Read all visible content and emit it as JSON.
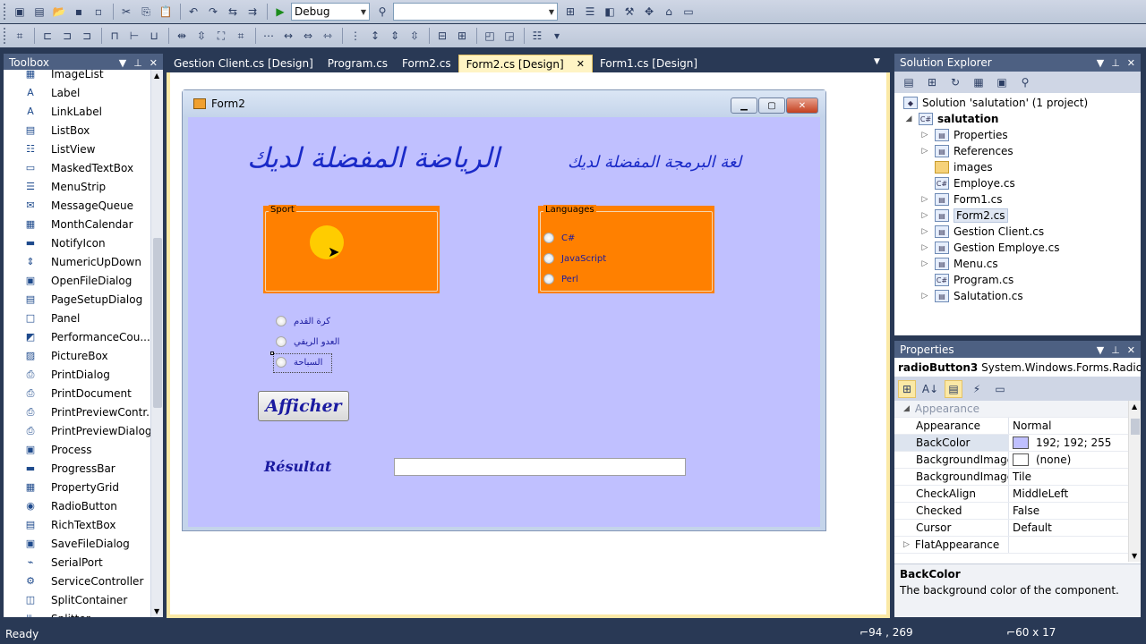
{
  "toolbar1": {
    "config_combo": "Debug",
    "platform_combo": ""
  },
  "toolbox": {
    "title": "Toolbox",
    "items": [
      {
        "label": "ImageList",
        "icon": "imagelist-icon"
      },
      {
        "label": "Label",
        "icon": "label-icon"
      },
      {
        "label": "LinkLabel",
        "icon": "linklabel-icon"
      },
      {
        "label": "ListBox",
        "icon": "listbox-icon"
      },
      {
        "label": "ListView",
        "icon": "listview-icon"
      },
      {
        "label": "MaskedTextBox",
        "icon": "maskedtextbox-icon"
      },
      {
        "label": "MenuStrip",
        "icon": "menustrip-icon"
      },
      {
        "label": "MessageQueue",
        "icon": "messagequeue-icon"
      },
      {
        "label": "MonthCalendar",
        "icon": "monthcalendar-icon"
      },
      {
        "label": "NotifyIcon",
        "icon": "notifyicon-icon"
      },
      {
        "label": "NumericUpDown",
        "icon": "numericupdown-icon"
      },
      {
        "label": "OpenFileDialog",
        "icon": "openfiledialog-icon"
      },
      {
        "label": "PageSetupDialog",
        "icon": "pagesetupdialog-icon"
      },
      {
        "label": "Panel",
        "icon": "panel-icon"
      },
      {
        "label": "PerformanceCou...",
        "icon": "performancecounter-icon"
      },
      {
        "label": "PictureBox",
        "icon": "picturebox-icon"
      },
      {
        "label": "PrintDialog",
        "icon": "printdialog-icon"
      },
      {
        "label": "PrintDocument",
        "icon": "printdocument-icon"
      },
      {
        "label": "PrintPreviewContr...",
        "icon": "printpreviewcontrol-icon"
      },
      {
        "label": "PrintPreviewDialog",
        "icon": "printpreviewdialog-icon"
      },
      {
        "label": "Process",
        "icon": "process-icon"
      },
      {
        "label": "ProgressBar",
        "icon": "progressbar-icon"
      },
      {
        "label": "PropertyGrid",
        "icon": "propertygrid-icon"
      },
      {
        "label": "RadioButton",
        "icon": "radiobutton-icon"
      },
      {
        "label": "RichTextBox",
        "icon": "richtextbox-icon"
      },
      {
        "label": "SaveFileDialog",
        "icon": "savefiledialog-icon"
      },
      {
        "label": "SerialPort",
        "icon": "serialport-icon"
      },
      {
        "label": "ServiceController",
        "icon": "servicecontroller-icon"
      },
      {
        "label": "SplitContainer",
        "icon": "splitcontainer-icon"
      },
      {
        "label": "Splitter",
        "icon": "splitter-icon"
      }
    ]
  },
  "tabs": [
    {
      "label": "Gestion Client.cs [Design]",
      "active": false
    },
    {
      "label": "Program.cs",
      "active": false
    },
    {
      "label": "Form2.cs",
      "active": false
    },
    {
      "label": "Form2.cs [Design]",
      "active": true
    },
    {
      "label": "Form1.cs [Design]",
      "active": false
    }
  ],
  "form": {
    "title": "Form2",
    "arabic_title_sport": "الرياضة المفضلة لديك",
    "arabic_title_lang": "لغة البرمجة المفضلة لديك",
    "group_sport": "Sport",
    "group_languages": "Languages",
    "languages": [
      "C#",
      "JavaScript",
      "Perl"
    ],
    "sports": [
      "كرة القدم",
      "العدو الريفي",
      "السباحة"
    ],
    "button_afficher": "Afficher",
    "label_resultat": "Résultat",
    "result_value": ""
  },
  "solution_explorer": {
    "title": "Solution Explorer",
    "solution": "Solution 'salutation' (1 project)",
    "project": "salutation",
    "items": [
      {
        "label": "Properties",
        "expandable": true,
        "icon": "properties-icon"
      },
      {
        "label": "References",
        "expandable": true,
        "icon": "references-icon"
      },
      {
        "label": "images",
        "expandable": false,
        "icon": "folder-icon"
      },
      {
        "label": "Employe.cs",
        "expandable": false,
        "icon": "cs-file-icon"
      },
      {
        "label": "Form1.cs",
        "expandable": true,
        "icon": "form-file-icon"
      },
      {
        "label": "Form2.cs",
        "expandable": true,
        "icon": "form-file-icon",
        "selected": true
      },
      {
        "label": "Gestion Client.cs",
        "expandable": true,
        "icon": "form-file-icon"
      },
      {
        "label": "Gestion Employe.cs",
        "expandable": true,
        "icon": "form-file-icon"
      },
      {
        "label": "Menu.cs",
        "expandable": true,
        "icon": "form-file-icon"
      },
      {
        "label": "Program.cs",
        "expandable": false,
        "icon": "cs-file-icon"
      },
      {
        "label": "Salutation.cs",
        "expandable": true,
        "icon": "form-file-icon"
      }
    ]
  },
  "properties": {
    "title": "Properties",
    "object_name": "radioButton3",
    "object_type": "System.Windows.Forms.RadioBu",
    "category": "Appearance",
    "rows": [
      {
        "name": "Appearance",
        "value": "Normal"
      },
      {
        "name": "BackColor",
        "value": "192; 192; 255",
        "swatch": "#c0c0ff",
        "selected": true
      },
      {
        "name": "BackgroundImage",
        "value": "(none)",
        "swatch": "#ffffff"
      },
      {
        "name": "BackgroundImageL",
        "value": "Tile"
      },
      {
        "name": "CheckAlign",
        "value": "MiddleLeft"
      },
      {
        "name": "Checked",
        "value": "False"
      },
      {
        "name": "Cursor",
        "value": "Default"
      },
      {
        "name": "FlatAppearance",
        "value": "",
        "expandable": true
      }
    ],
    "desc_title": "BackColor",
    "desc_text": "The background color of the component."
  },
  "status": {
    "text": "Ready",
    "position": "94 , 269",
    "size": "60 x 17"
  },
  "colors": {
    "form_back": "#c0c0ff",
    "group_back": "#ff8000",
    "title_text": "#1a2ac8"
  }
}
